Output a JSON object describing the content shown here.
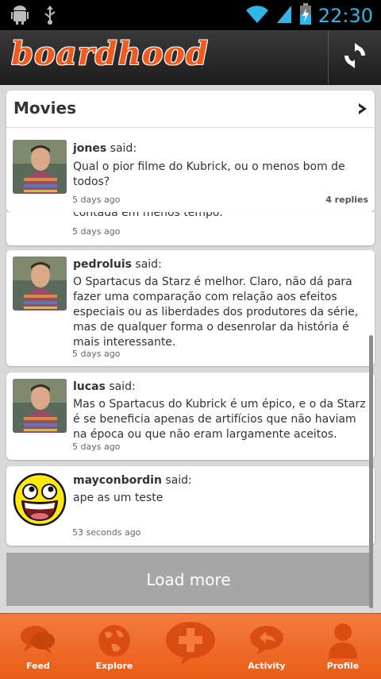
{
  "status_bar": {
    "time": "22:30"
  },
  "app": {
    "logo_text": "boardhood"
  },
  "topic": {
    "title": "Movies"
  },
  "posts": [
    {
      "author": "jones",
      "said": "said:",
      "body": "Qual o pior filme do Kubrick, ou o menos bom de todos?",
      "time": "5 days ago",
      "replies": "4 replies"
    },
    {
      "author": "",
      "said": "",
      "body": "contada em menos tempo.",
      "time": "5 days ago"
    },
    {
      "author": "pedroluis",
      "said": "said:",
      "body": "O Spartacus da Starz é melhor. Claro, não dá para fazer uma comparação com relação aos efeitos especiais ou as liberdades dos produtores da série, mas de qualquer forma o desenrolar da história é mais interessante.",
      "time": "5 days ago"
    },
    {
      "author": "lucas",
      "said": "said:",
      "body": "Mas o Spartacus do Kubrick é um épico, e o da Starz é se beneficia apenas de artifícios que não haviam na época ou que não eram largamente aceitos.",
      "time": "5 days ago"
    },
    {
      "author": "mayconbordin",
      "said": "said:",
      "body": "ape as um teste",
      "time": "53 seconds ago"
    }
  ],
  "load_more": "Load more",
  "tabs": [
    {
      "label": "Feed",
      "icon": "speech-bubbles-icon"
    },
    {
      "label": "Explore",
      "icon": "globe-icon"
    },
    {
      "label": "",
      "icon": "add-post-icon"
    },
    {
      "label": "Activity",
      "icon": "reply-bubble-icon"
    },
    {
      "label": "Profile",
      "icon": "person-icon"
    }
  ]
}
